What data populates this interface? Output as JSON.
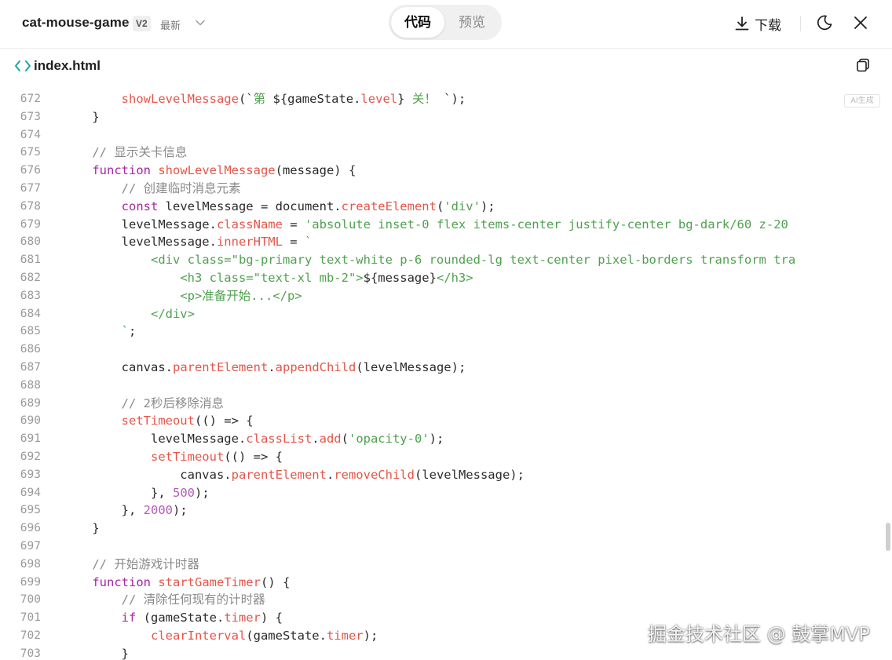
{
  "header": {
    "project_title": "cat-mouse-game",
    "version": "V2",
    "latest": "最新",
    "tab_code": "代码",
    "tab_preview": "预览",
    "download": "下载"
  },
  "file": {
    "name": "index.html"
  },
  "ai_badge": "AI生成",
  "watermark": "掘金技术社区 @ 鼓掌MVP",
  "code_lines": [
    {
      "n": "672",
      "tokens": [
        [
          "",
          "        "
        ],
        [
          "fn",
          "showLevelMessage"
        ],
        [
          "",
          "(`"
        ],
        [
          "str",
          "第 "
        ],
        [
          "",
          "${gameState."
        ],
        [
          "fn",
          "level"
        ],
        [
          "",
          "} "
        ],
        [
          "str",
          "关！ "
        ],
        [
          "",
          "`);"
        ]
      ]
    },
    {
      "n": "673",
      "tokens": [
        [
          "",
          "    }"
        ]
      ]
    },
    {
      "n": "674",
      "tokens": [
        [
          "",
          ""
        ]
      ]
    },
    {
      "n": "675",
      "tokens": [
        [
          "",
          "    "
        ],
        [
          "cm",
          "// 显示关卡信息"
        ]
      ]
    },
    {
      "n": "676",
      "tokens": [
        [
          "",
          "    "
        ],
        [
          "kw",
          "function"
        ],
        [
          "",
          " "
        ],
        [
          "fn",
          "showLevelMessage"
        ],
        [
          "",
          "(message) {"
        ]
      ]
    },
    {
      "n": "677",
      "tokens": [
        [
          "",
          "        "
        ],
        [
          "cm",
          "// 创建临时消息元素"
        ]
      ]
    },
    {
      "n": "678",
      "tokens": [
        [
          "",
          "        "
        ],
        [
          "kw",
          "const"
        ],
        [
          "",
          " levelMessage = document."
        ],
        [
          "fn",
          "createElement"
        ],
        [
          "",
          "("
        ],
        [
          "str",
          "'div'"
        ],
        [
          "",
          ");"
        ]
      ]
    },
    {
      "n": "679",
      "tokens": [
        [
          "",
          "        levelMessage."
        ],
        [
          "fn",
          "className"
        ],
        [
          "",
          " = "
        ],
        [
          "str",
          "'absolute inset-0 flex items-center justify-center bg-dark/60 z-20"
        ]
      ]
    },
    {
      "n": "680",
      "tokens": [
        [
          "",
          "        levelMessage."
        ],
        [
          "fn",
          "innerHTML"
        ],
        [
          "",
          " = "
        ],
        [
          "str",
          "`"
        ]
      ]
    },
    {
      "n": "681",
      "tokens": [
        [
          "",
          "            "
        ],
        [
          "str",
          "<div class=\"bg-primary text-white p-6 rounded-lg text-center pixel-borders transform tra"
        ]
      ]
    },
    {
      "n": "682",
      "tokens": [
        [
          "",
          "                "
        ],
        [
          "str",
          "<h3 class=\"text-xl mb-2\">"
        ],
        [
          "",
          "${message}"
        ],
        [
          "str",
          "</h3>"
        ]
      ]
    },
    {
      "n": "683",
      "tokens": [
        [
          "",
          "                "
        ],
        [
          "str",
          "<p>准备开始...</p>"
        ]
      ]
    },
    {
      "n": "684",
      "tokens": [
        [
          "",
          "            "
        ],
        [
          "str",
          "</div>"
        ]
      ]
    },
    {
      "n": "685",
      "tokens": [
        [
          "",
          "        "
        ],
        [
          "str",
          "`"
        ],
        [
          "",
          ";"
        ]
      ]
    },
    {
      "n": "686",
      "tokens": [
        [
          "",
          ""
        ]
      ]
    },
    {
      "n": "687",
      "tokens": [
        [
          "",
          "        canvas."
        ],
        [
          "fn",
          "parentElement"
        ],
        [
          "",
          "."
        ],
        [
          "fn",
          "appendChild"
        ],
        [
          "",
          "(levelMessage);"
        ]
      ]
    },
    {
      "n": "688",
      "tokens": [
        [
          "",
          ""
        ]
      ]
    },
    {
      "n": "689",
      "tokens": [
        [
          "",
          "        "
        ],
        [
          "cm",
          "// 2秒后移除消息"
        ]
      ]
    },
    {
      "n": "690",
      "tokens": [
        [
          "",
          "        "
        ],
        [
          "fn",
          "setTimeout"
        ],
        [
          "",
          "(() => {"
        ]
      ]
    },
    {
      "n": "691",
      "tokens": [
        [
          "",
          "            levelMessage."
        ],
        [
          "fn",
          "classList"
        ],
        [
          "",
          "."
        ],
        [
          "fn",
          "add"
        ],
        [
          "",
          "("
        ],
        [
          "str",
          "'opacity-0'"
        ],
        [
          "",
          ");"
        ]
      ]
    },
    {
      "n": "692",
      "tokens": [
        [
          "",
          "            "
        ],
        [
          "fn",
          "setTimeout"
        ],
        [
          "",
          "(() => {"
        ]
      ]
    },
    {
      "n": "693",
      "tokens": [
        [
          "",
          "                canvas."
        ],
        [
          "fn",
          "parentElement"
        ],
        [
          "",
          "."
        ],
        [
          "fn",
          "removeChild"
        ],
        [
          "",
          "(levelMessage);"
        ]
      ]
    },
    {
      "n": "694",
      "tokens": [
        [
          "",
          "            }, "
        ],
        [
          "num",
          "500"
        ],
        [
          "",
          ");"
        ]
      ]
    },
    {
      "n": "695",
      "tokens": [
        [
          "",
          "        }, "
        ],
        [
          "num",
          "2000"
        ],
        [
          "",
          ");"
        ]
      ]
    },
    {
      "n": "696",
      "tokens": [
        [
          "",
          "    }"
        ]
      ]
    },
    {
      "n": "697",
      "tokens": [
        [
          "",
          ""
        ]
      ]
    },
    {
      "n": "698",
      "tokens": [
        [
          "",
          "    "
        ],
        [
          "cm",
          "// 开始游戏计时器"
        ]
      ]
    },
    {
      "n": "699",
      "tokens": [
        [
          "",
          "    "
        ],
        [
          "kw",
          "function"
        ],
        [
          "",
          " "
        ],
        [
          "fn",
          "startGameTimer"
        ],
        [
          "",
          "() {"
        ]
      ]
    },
    {
      "n": "700",
      "tokens": [
        [
          "",
          "        "
        ],
        [
          "cm",
          "// 清除任何现有的计时器"
        ]
      ]
    },
    {
      "n": "701",
      "tokens": [
        [
          "",
          "        "
        ],
        [
          "kw",
          "if"
        ],
        [
          "",
          " (gameState."
        ],
        [
          "fn",
          "timer"
        ],
        [
          "",
          ") {"
        ]
      ]
    },
    {
      "n": "702",
      "tokens": [
        [
          "",
          "            "
        ],
        [
          "fn",
          "clearInterval"
        ],
        [
          "",
          "(gameState."
        ],
        [
          "fn",
          "timer"
        ],
        [
          "",
          ");"
        ]
      ]
    },
    {
      "n": "703",
      "tokens": [
        [
          "",
          "        }"
        ]
      ]
    }
  ],
  "colors": {
    "keyword": "#a626a4",
    "function": "#e45649",
    "string": "#50a14f",
    "comment": "#8a8a8a",
    "number": "#b55db8",
    "accent_code_icon": "#1aa6a6"
  }
}
